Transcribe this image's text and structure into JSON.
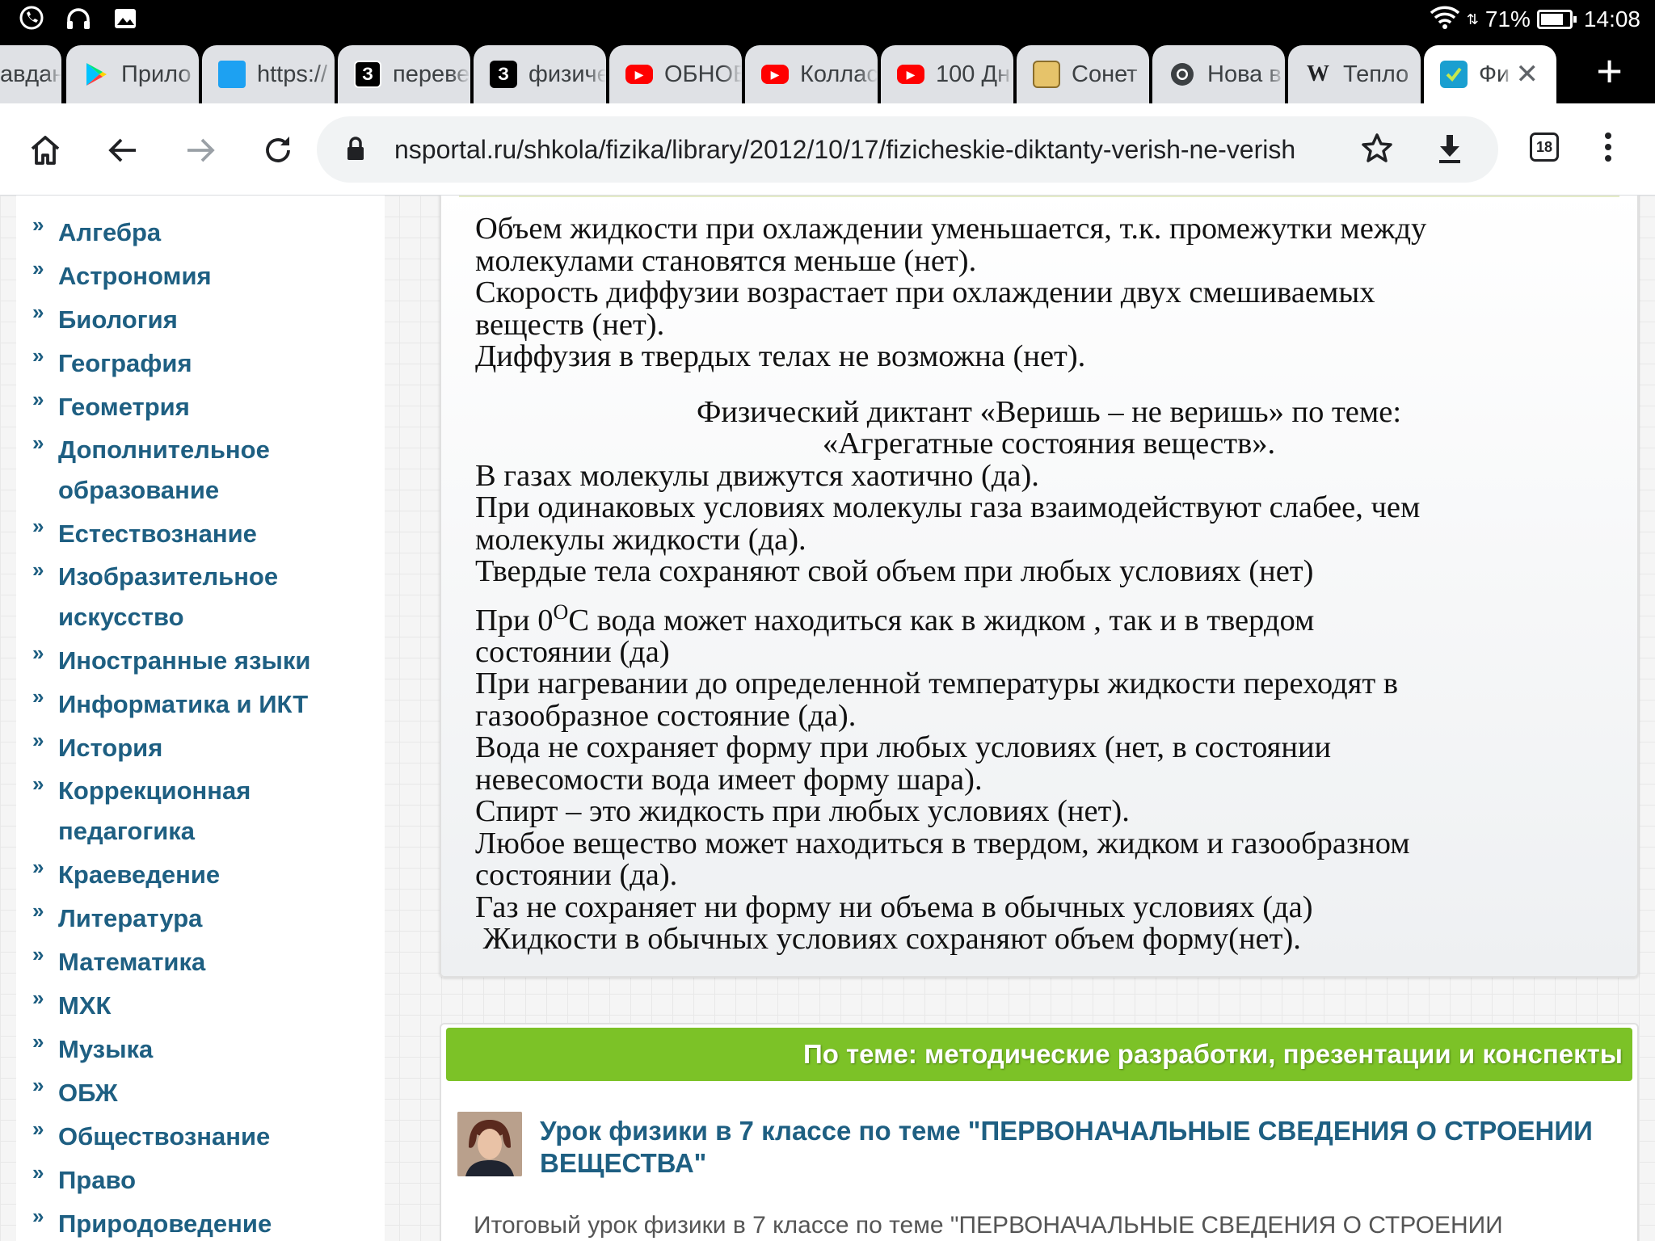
{
  "status_bar": {
    "battery": "71%",
    "time": "14:08"
  },
  "tabs": [
    {
      "title": "авдан",
      "icon": "none"
    },
    {
      "title": "Прило",
      "icon": "play-store-icon"
    },
    {
      "title": "https://",
      "icon": "blue-app-icon"
    },
    {
      "title": "переве",
      "icon": "znanija-icon"
    },
    {
      "title": "физиче",
      "icon": "znanija-icon"
    },
    {
      "title": "ОБНОВ",
      "icon": "youtube-icon"
    },
    {
      "title": "Коллас",
      "icon": "youtube-icon"
    },
    {
      "title": "100 Дн",
      "icon": "youtube-icon"
    },
    {
      "title": "Сонет",
      "icon": "image-icon"
    },
    {
      "title": "Нова в",
      "icon": "chrome-icon"
    },
    {
      "title": "Тепло",
      "icon": "wikipedia-icon"
    },
    {
      "title": "Фи",
      "icon": "nsportal-icon",
      "active": true
    }
  ],
  "toolbar": {
    "url": "nsportal.ru/shkola/fizika/library/2012/10/17/fizicheskie-diktanty-verish-ne-verish",
    "tab_count": "18"
  },
  "sidebar": {
    "items": [
      "Алгебра",
      "Астрономия",
      "Биология",
      "География",
      "Геометрия",
      "Дополнительное образование",
      "Естествознание",
      "Изобразительное искусство",
      "Иностранные языки",
      "Информатика и ИКТ",
      "История",
      "Коррекционная педагогика",
      "Краеведение",
      "Литература",
      "Математика",
      "МХК",
      "Музыка",
      "ОБЖ",
      "Обществознание",
      "Право",
      "Природоведение"
    ]
  },
  "article": {
    "lines_top": [
      "Объем жидкости при охлаждении уменьшается, т.к. промежутки между",
      "молекулами становятся меньше (нет).",
      "Скорость диффузии возрастает при охлаждении двух смешиваемых",
      "веществ (нет).",
      "Диффузия в твердых телах не возможна (нет)."
    ],
    "heading_1": "Физический диктант «Веришь – не веришь» по теме:",
    "heading_2": "«Агрегатные состояния веществ».",
    "lines_a": [
      "В газах молекулы движутся хаотично (да).",
      "При одинаковых условиях молекулы газа взаимодействуют слабее, чем",
      "молекулы жидкости (да).",
      "Твердые тела сохраняют свой объем при любых условиях (нет)"
    ],
    "temp_line_prefix": "При 0",
    "temp_line_sup": "О",
    "temp_line_rest": "С  вода может находиться как в жидком , так и в твердом",
    "lines_b": [
      "состоянии (да)",
      "При нагревании до определенной температуры  жидкости переходят в",
      "газообразное состояние (да).",
      "Вода не сохраняет форму при любых условиях (нет, в состоянии",
      "невесомости вода имеет форму шара).",
      "Спирт – это жидкость при любых условиях (нет).",
      "Любое вещество может находиться  в твердом, жидком и газообразном",
      "состоянии (да).",
      "Газ не сохраняет ни форму  ни объема в обычных условиях (да)",
      " Жидкости в обычных условиях сохраняют объем форму(нет)."
    ]
  },
  "related": {
    "header": "По теме: методические разработки, презентации и конспекты",
    "lesson_title": "Урок физики в 7 классе по теме \"ПЕРВОНАЧАЛЬНЫЕ СВЕДЕНИЯ О СТРОЕНИИ ВЕЩЕСТВА\"",
    "lesson_desc": "Итоговый урок физики в 7 классе по теме \"ПЕРВОНАЧАЛЬНЫЕ СВЕДЕНИЯ О СТРОЕНИИ"
  },
  "colors": {
    "link": "#1e5f82",
    "green_header": "#7cc227"
  }
}
